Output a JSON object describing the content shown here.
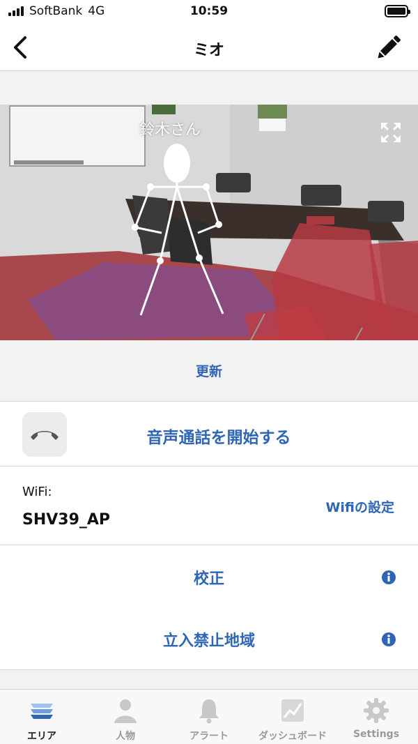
{
  "status_bar": {
    "carrier": "SoftBank",
    "network": "4G",
    "time": "10:59"
  },
  "nav": {
    "title": "ミオ",
    "back_icon": "chevron-left-icon",
    "edit_icon": "pencil-icon"
  },
  "camera": {
    "person_label": "鈴木さん",
    "expand_icon": "expand-icon"
  },
  "refresh": {
    "label": "更新"
  },
  "call": {
    "label": "音声通話を開始する",
    "icon": "phone-icon"
  },
  "wifi": {
    "caption": "WiFi:",
    "ssid": "SHV39_AP",
    "settings_label": "Wifiの設定"
  },
  "rows": [
    {
      "label": "校正",
      "icon": "info-icon"
    },
    {
      "label": "立入禁止地域",
      "icon": "info-icon"
    }
  ],
  "tabs": [
    {
      "label": "エリア",
      "icon": "layers-icon",
      "active": true
    },
    {
      "label": "人物",
      "icon": "person-icon",
      "active": false
    },
    {
      "label": "アラート",
      "icon": "bell-icon",
      "active": false
    },
    {
      "label": "ダッシュボード",
      "icon": "chart-icon",
      "active": false
    },
    {
      "label": "Settings",
      "icon": "gear-icon",
      "active": false
    }
  ],
  "colors": {
    "accent": "#2f65b6",
    "restricted_overlay": "#c0272d",
    "tab_active": "#2f65b6",
    "tab_inactive": "#c8c8c8"
  }
}
